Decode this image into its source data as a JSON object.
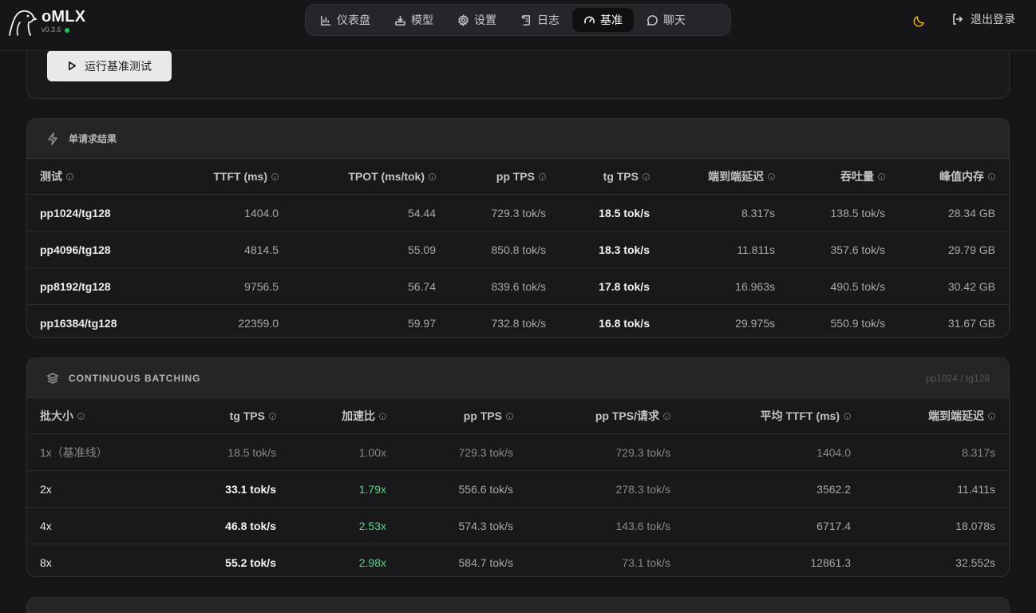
{
  "brand": {
    "name": "oMLX",
    "version": "v0.3.6"
  },
  "nav": [
    {
      "label": "仪表盘",
      "icon": "chart-icon",
      "active": false
    },
    {
      "label": "模型",
      "icon": "download-icon",
      "active": false
    },
    {
      "label": "设置",
      "icon": "gear-icon",
      "active": false
    },
    {
      "label": "日志",
      "icon": "scroll-icon",
      "active": false
    },
    {
      "label": "基准",
      "icon": "gauge-icon",
      "active": true
    },
    {
      "label": "聊天",
      "icon": "chat-icon",
      "active": false
    }
  ],
  "header": {
    "logout_label": "退出登录"
  },
  "run": {
    "label": "运行基准测试"
  },
  "single": {
    "title": "单请求结果",
    "columns": [
      "测试",
      "TTFT (ms)",
      "TPOT (ms/tok)",
      "pp TPS",
      "tg TPS",
      "端到端延迟",
      "吞吐量",
      "峰值内存"
    ],
    "rows": [
      [
        "pp1024/tg128",
        "1404.0",
        "54.44",
        "729.3 tok/s",
        "18.5 tok/s",
        "8.317s",
        "138.5 tok/s",
        "28.34 GB"
      ],
      [
        "pp4096/tg128",
        "4814.5",
        "55.09",
        "850.8 tok/s",
        "18.3 tok/s",
        "11.811s",
        "357.6 tok/s",
        "29.79 GB"
      ],
      [
        "pp8192/tg128",
        "9756.5",
        "56.74",
        "839.6 tok/s",
        "17.8 tok/s",
        "16.963s",
        "490.5 tok/s",
        "30.42 GB"
      ],
      [
        "pp16384/tg128",
        "22359.0",
        "59.97",
        "732.8 tok/s",
        "16.8 tok/s",
        "29.975s",
        "550.9 tok/s",
        "31.67 GB"
      ]
    ]
  },
  "batch": {
    "title": "CONTINUOUS BATCHING",
    "note": "pp1024 / tg128",
    "columns": [
      "批大小",
      "tg TPS",
      "加速比",
      "pp TPS",
      "pp TPS/请求",
      "平均 TTFT (ms)",
      "端到端延迟"
    ],
    "rows": [
      [
        "1x（基准线）",
        "18.5 tok/s",
        "1.00x",
        "729.3 tok/s",
        "729.3 tok/s",
        "1404.0",
        "8.317s"
      ],
      [
        "2x",
        "33.1 tok/s",
        "1.79x",
        "556.6 tok/s",
        "278.3 tok/s",
        "3562.2",
        "11.411s"
      ],
      [
        "4x",
        "46.8 tok/s",
        "2.53x",
        "574.3 tok/s",
        "143.6 tok/s",
        "6717.4",
        "18.078s"
      ],
      [
        "8x",
        "55.2 tok/s",
        "2.98x",
        "584.7 tok/s",
        "73.1 tok/s",
        "12861.3",
        "32.552s"
      ]
    ]
  },
  "colors": {
    "accent_green": "#4ade80",
    "status_dot": "#22c55e",
    "moon": "#eab308"
  }
}
